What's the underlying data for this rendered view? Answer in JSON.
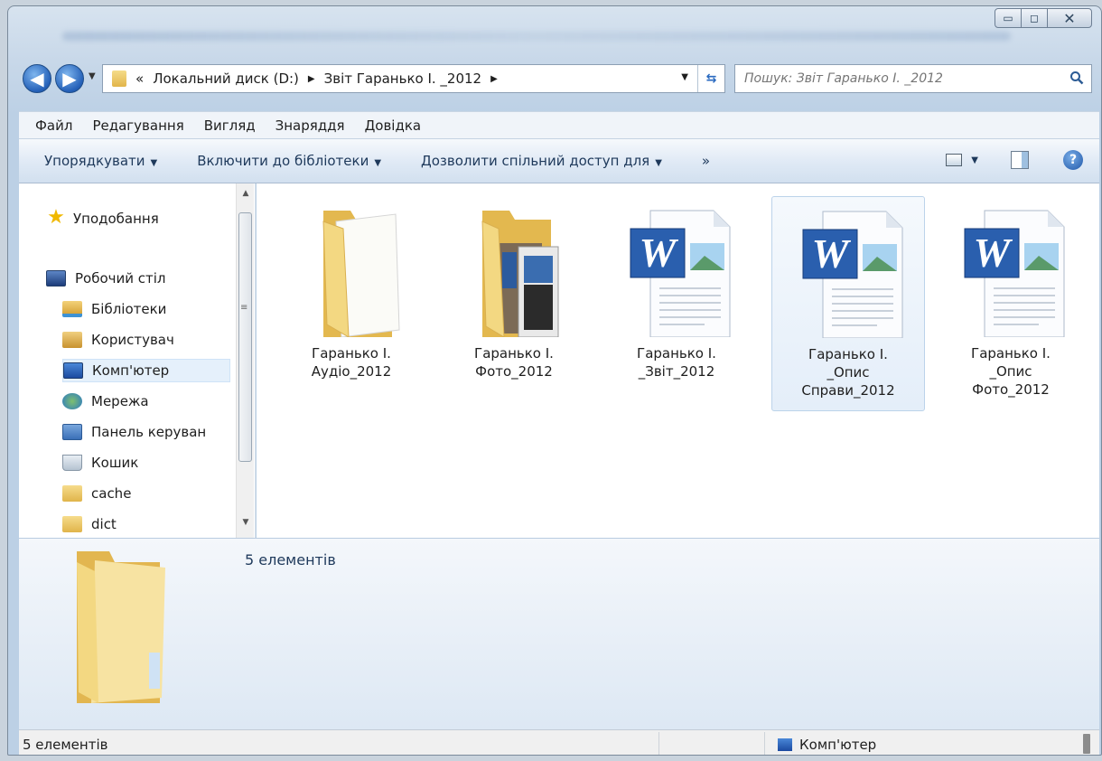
{
  "window": {
    "controls": {
      "minimize": "▭",
      "maximize": "◻",
      "close": "✕"
    }
  },
  "nav": {
    "back_icon": "arrow-left-icon",
    "forward_icon": "arrow-right-icon",
    "address": {
      "overflow": "«",
      "segments": [
        "Локальний диск (D:)",
        "Звіт Гаранько І. _2012"
      ]
    },
    "search_placeholder": "Пошук: Звіт Гаранько І. _2012"
  },
  "menu": [
    "Файл",
    "Редагування",
    "Вигляд",
    "Знаряддя",
    "Довідка"
  ],
  "toolbar": {
    "organize": "Упорядкувати",
    "include_library": "Включити до бібліотеки",
    "share_with": "Дозволити спільний доступ для",
    "more": "»"
  },
  "sidebar": {
    "items": [
      {
        "label": "Уподобання",
        "icon": "star-icon"
      },
      {
        "label": "Робочий стіл",
        "icon": "desktop-icon"
      },
      {
        "label": "Бібліотеки",
        "icon": "library-icon"
      },
      {
        "label": "Користувач",
        "icon": "user-folder-icon"
      },
      {
        "label": "Комп'ютер",
        "icon": "computer-icon",
        "selected": true
      },
      {
        "label": "Мережа",
        "icon": "network-icon"
      },
      {
        "label": "Панель керуван",
        "icon": "control-panel-icon"
      },
      {
        "label": "Кошик",
        "icon": "recycle-bin-icon"
      },
      {
        "label": "cache",
        "icon": "folder-icon"
      },
      {
        "label": "dict",
        "icon": "folder-icon"
      }
    ]
  },
  "files": [
    {
      "lines": [
        "Гаранько І.",
        "Аудіо_2012"
      ],
      "type": "folder"
    },
    {
      "lines": [
        "Гаранько І.",
        "Фото_2012"
      ],
      "type": "photo-folder"
    },
    {
      "lines": [
        "Гаранько І.",
        "_Звіт_2012"
      ],
      "type": "word-doc"
    },
    {
      "lines": [
        "Гаранько І.",
        "_Опис",
        "Справи_2012"
      ],
      "type": "word-doc",
      "selected": true
    },
    {
      "lines": [
        "Гаранько І.",
        "_Опис",
        "Фото_2012"
      ],
      "type": "word-doc"
    }
  ],
  "details": {
    "count": "5 елементів"
  },
  "status": {
    "count": "5 елементів",
    "location": "Комп'ютер"
  }
}
